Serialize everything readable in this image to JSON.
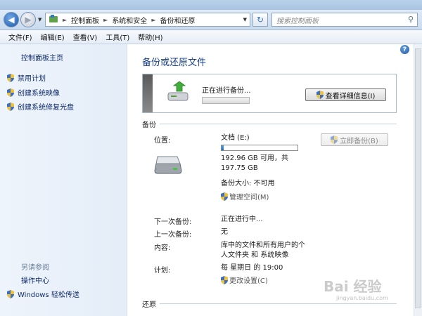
{
  "address": {
    "crumbs": [
      "控制面板",
      "系统和安全",
      "备份和还原"
    ],
    "search_placeholder": "搜索控制面板"
  },
  "menu": [
    "文件(F)",
    "编辑(E)",
    "查看(V)",
    "工具(T)",
    "帮助(H)"
  ],
  "sidebar": {
    "home": "控制面板主页",
    "items": [
      "禁用计划",
      "创建系统映像",
      "创建系统修复光盘"
    ],
    "see_also": "另请参阅",
    "bottom": [
      "操作中心",
      "Windows 轻松传送"
    ]
  },
  "main": {
    "title": "备份或还原文件",
    "progress": {
      "status": "正在进行备份...",
      "details_button": "查看详细信息(I)"
    },
    "backup_section": "备份",
    "location_label": "位置:",
    "location_value": "文档 (E:)",
    "disk_used_fraction": 0.03,
    "free_space_line1": "192.96 GB 可用，共",
    "free_space_line2": "197.75 GB",
    "backup_size": "备份大小: 不可用",
    "manage_space": "管理空间(M)",
    "backup_now_button": "立即备份(B)",
    "next_label": "下一次备份:",
    "next_value": "正在进行中...",
    "last_label": "上一次备份:",
    "last_value": "无",
    "contents_label": "内容:",
    "contents_line1": "库中的文件和所有用户的个",
    "contents_line2": "人文件夹 和 系统映像",
    "schedule_label": "计划:",
    "schedule_value": "每 星期日 的 19:00",
    "change_settings": "更改设置(C)",
    "restore_section": "还原"
  },
  "watermark": {
    "text": "Bai 经验",
    "sub": "jingyan.baidu.com"
  }
}
